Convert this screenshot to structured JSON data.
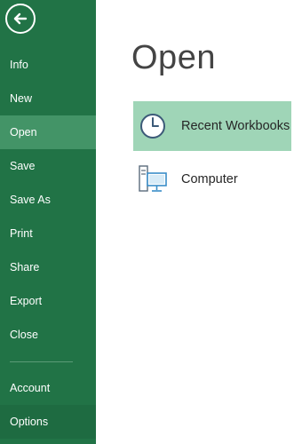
{
  "sidebar": {
    "back_icon": "back-arrow-icon",
    "items": [
      {
        "label": "Info"
      },
      {
        "label": "New"
      },
      {
        "label": "Open"
      },
      {
        "label": "Save"
      },
      {
        "label": "Save As"
      },
      {
        "label": "Print"
      },
      {
        "label": "Share"
      },
      {
        "label": "Export"
      },
      {
        "label": "Close"
      }
    ],
    "bottom_items": [
      {
        "label": "Account"
      },
      {
        "label": "Options"
      }
    ],
    "selected": "Open"
  },
  "main": {
    "title": "Open",
    "locations": [
      {
        "label": "Recent Workbooks",
        "icon": "clock-icon",
        "selected": true
      },
      {
        "label": "Computer",
        "icon": "computer-icon",
        "selected": false
      }
    ]
  },
  "colors": {
    "sidebar_bg": "#217346",
    "sidebar_selected": "#439467",
    "location_selected": "#9fd5b7"
  }
}
